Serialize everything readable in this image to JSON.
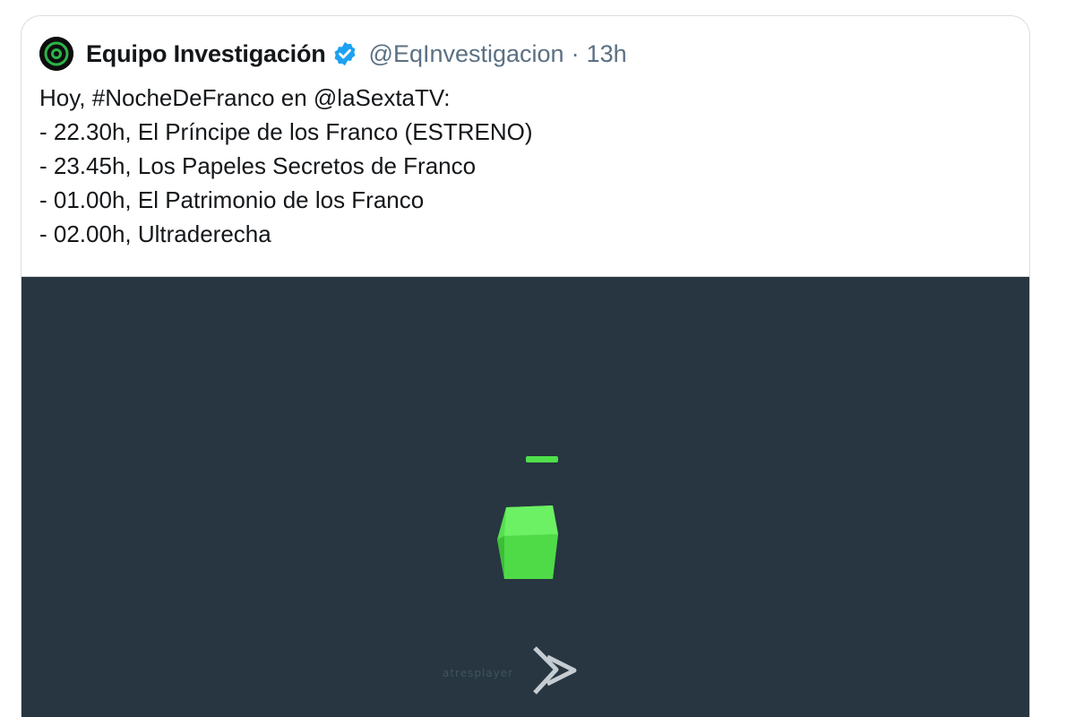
{
  "tweet": {
    "display_name": "Equipo Investigación",
    "handle": "@EqInvestigacion",
    "separator": "·",
    "time": "13h",
    "lines": [
      "Hoy, #NocheDeFranco en @laSextaTV:",
      "- 22.30h, El Príncipe de los Franco (ESTRENO)",
      "- 23.45h, Los Papeles Secretos de Franco",
      "- 01.00h, El Patrimonio de los Franco",
      "- 02.00h, Ultraderecha"
    ]
  },
  "media": {
    "player_name": "atresplayer",
    "background_color": "#273640",
    "accent_color": "#4fe04a"
  },
  "icons": {
    "avatar": "avatar-icon",
    "verified": "verified-badge-icon",
    "loader": "loading-cube-icon",
    "player_logo": "atresplayer-chevron-icon"
  }
}
